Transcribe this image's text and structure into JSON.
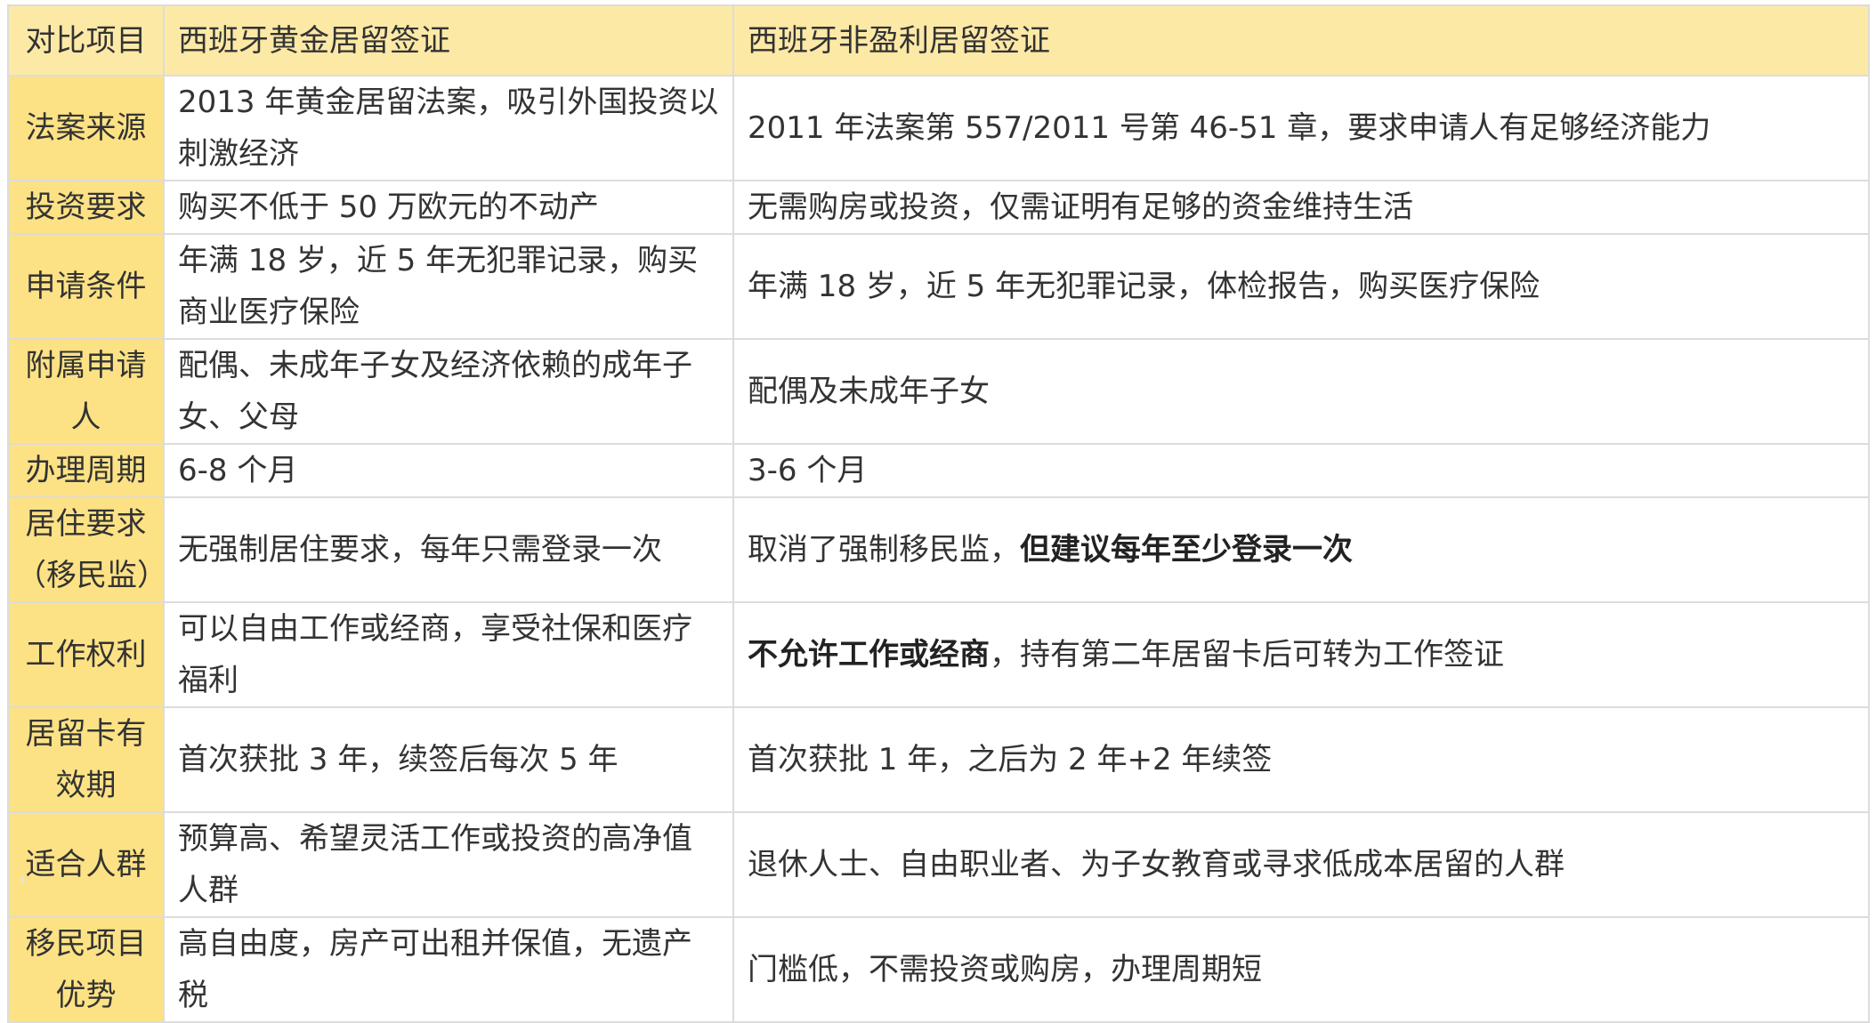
{
  "header": {
    "item": "对比项目",
    "golden": "西班牙黄金居留签证",
    "nonprofit": "西班牙非盈利居留签证"
  },
  "rows": [
    {
      "item": "法案来源",
      "golden": "2013 年黄金居留法案，吸引外国投资以刺激经济",
      "nonprofit": "2011 年法案第 557/2011 号第 46-51 章，要求申请人有足够经济能力"
    },
    {
      "item": "投资要求",
      "golden": "购买不低于 50 万欧元的不动产",
      "nonprofit": "无需购房或投资，仅需证明有足够的资金维持生活"
    },
    {
      "item": "申请条件",
      "golden": "年满 18 岁，近 5 年无犯罪记录，购买商业医疗保险",
      "nonprofit": "年满 18 岁，近 5 年无犯罪记录，体检报告，购买医疗保险"
    },
    {
      "item": "附属申请人",
      "golden": "配偶、未成年子女及经济依赖的成年子女、父母",
      "nonprofit": "配偶及未成年子女"
    },
    {
      "item": "办理周期",
      "golden": "6-8 个月",
      "nonprofit": "3-6 个月"
    },
    {
      "item": "居住要求（移民监）",
      "golden": "无强制居住要求，每年只需登录一次",
      "nonprofit_prefix": "取消了强制移民监，",
      "nonprofit_bold": "但建议每年至少登录一次"
    },
    {
      "item": "工作权利",
      "golden": "可以自由工作或经商，享受社保和医疗福利",
      "nonprofit_bold": "不允许工作或经商",
      "nonprofit_suffix": "，持有第二年居留卡后可转为工作签证"
    },
    {
      "item": "居留卡有效期",
      "golden": "首次获批 3 年，续签后每次 5 年",
      "nonprofit": "首次获批 1 年，之后为 2 年+2 年续签"
    },
    {
      "item": "适合人群",
      "golden": "预算高、希望灵活工作或投资的高净值人群",
      "nonprofit": "退休人士、自由职业者、为子女教育或寻求低成本居留的人群"
    },
    {
      "item": "移民项目优势",
      "golden": "高自由度，房产可出租并保值，无遗产税",
      "nonprofit": "门槛低，不需投资或购房，办理周期短"
    }
  ],
  "colors": {
    "header_bg": "#fde9a6",
    "item_bg": "#fde285",
    "border": "#dcdcdc",
    "text": "#333333"
  }
}
